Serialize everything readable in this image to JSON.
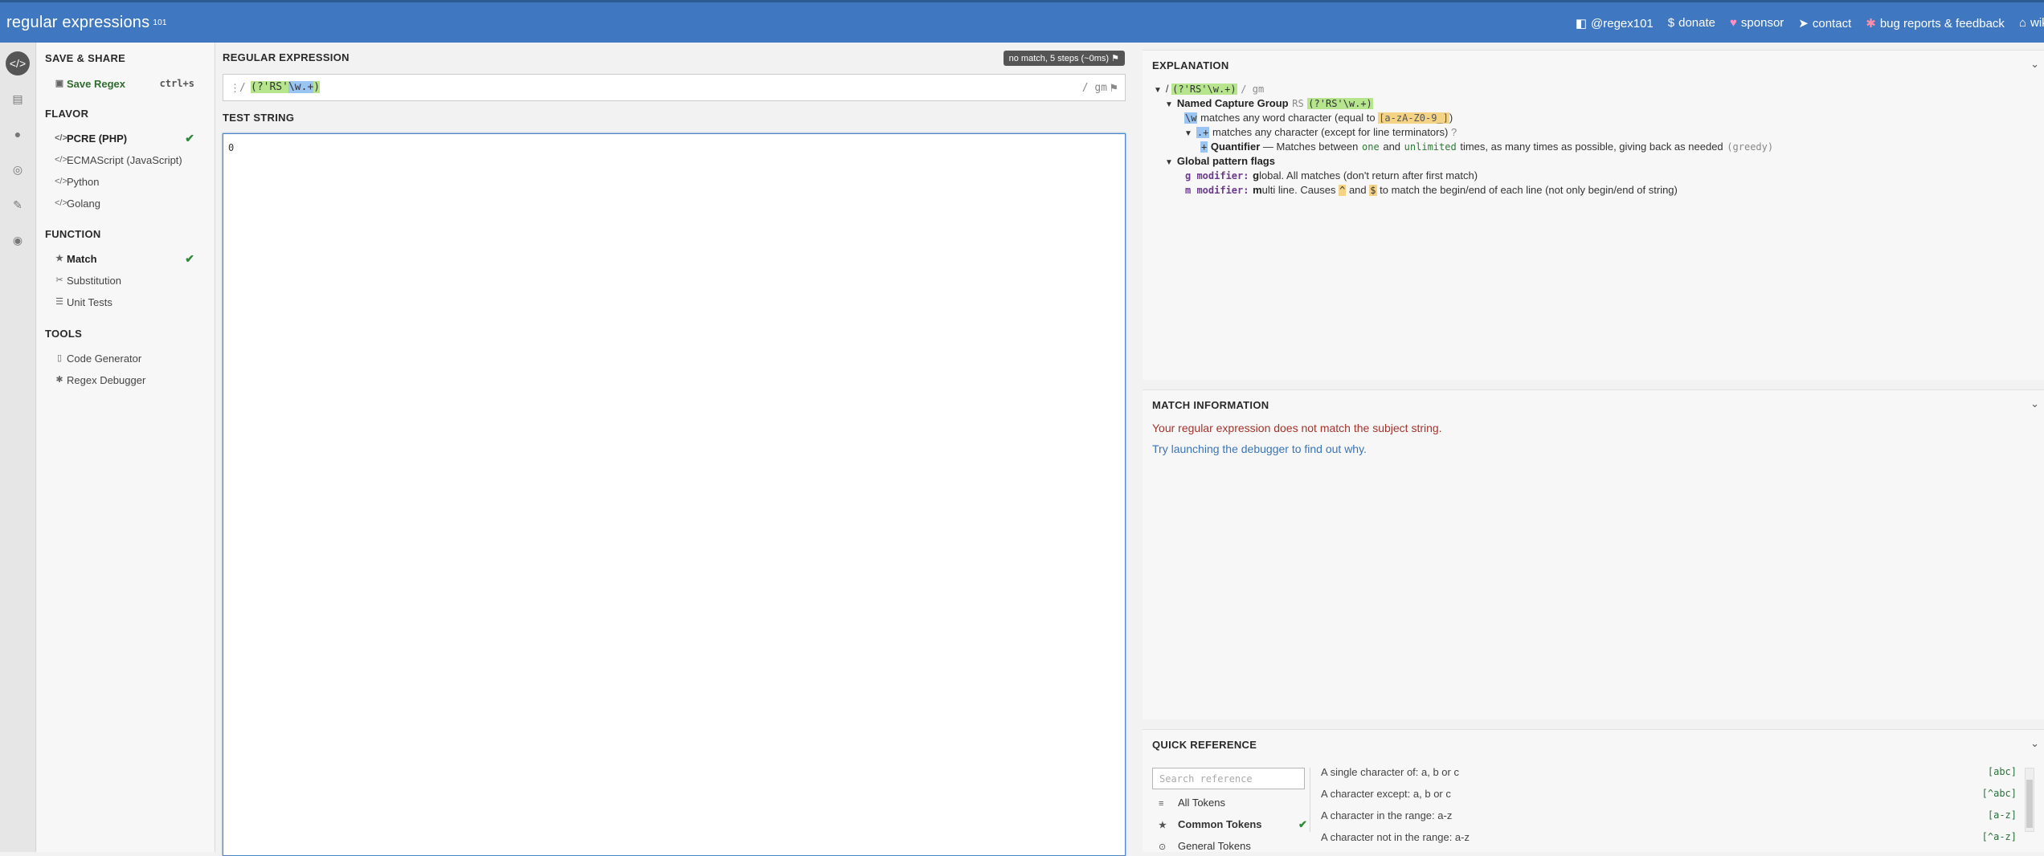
{
  "header": {
    "logo": "regular expressions",
    "logo_sub": "101",
    "links": [
      {
        "icon": "twitter-icon",
        "glyph": "◧",
        "label": "@regex101"
      },
      {
        "icon": "dollar-icon",
        "glyph": "$",
        "label": "donate"
      },
      {
        "icon": "heart-icon",
        "glyph": "♥",
        "label": "sponsor"
      },
      {
        "icon": "send-icon",
        "glyph": "➤",
        "label": "contact"
      },
      {
        "icon": "bug-icon",
        "glyph": "✱",
        "label": "bug reports & feedback"
      },
      {
        "icon": "bank-icon",
        "glyph": "⌂",
        "label": "wiki"
      }
    ]
  },
  "sidebar": {
    "save_share": {
      "title": "SAVE & SHARE",
      "save_label": "Save Regex",
      "shortcut": "ctrl+s"
    },
    "flavor": {
      "title": "FLAVOR",
      "items": [
        {
          "label": "PCRE (PHP)",
          "selected": true
        },
        {
          "label": "ECMAScript (JavaScript)",
          "selected": false
        },
        {
          "label": "Python",
          "selected": false
        },
        {
          "label": "Golang",
          "selected": false
        }
      ]
    },
    "function": {
      "title": "FUNCTION",
      "items": [
        {
          "label": "Match",
          "selected": true
        },
        {
          "label": "Substitution",
          "selected": false
        },
        {
          "label": "Unit Tests",
          "selected": false
        }
      ]
    },
    "tools": {
      "title": "TOOLS",
      "items": [
        {
          "label": "Code Generator"
        },
        {
          "label": "Regex Debugger"
        }
      ]
    }
  },
  "editor": {
    "regex_label": "REGULAR EXPRESSION",
    "status": "no match, 5 steps (~0ms)",
    "delimiter_open": "/",
    "regex_parts": {
      "group_open": "(?'RS'",
      "escape": "\\w",
      "quant": ".+",
      "group_close": ")"
    },
    "flags": "/ gm",
    "test_label": "TEST STRING",
    "test_string": "0"
  },
  "explanation": {
    "title": "EXPLANATION",
    "root": {
      "open": "/",
      "regex": "(?'RS'\\w.+)",
      "close": "/ gm"
    },
    "group": {
      "label": "Named Capture Group",
      "name": "RS",
      "token": "(?'RS'\\w.+)"
    },
    "word": {
      "token": "\\w",
      "text": "matches any word character (equal to",
      "class": "[a-zA-Z0-9_]",
      "close": ")"
    },
    "any": {
      "token": ".+",
      "text": "matches any character (except for line terminators)"
    },
    "quant": {
      "token": "+",
      "label": "Quantifier",
      "text1": "— Matches between",
      "one": "one",
      "and": "and",
      "unlimited": "unlimited",
      "text2": "times, as many times as possible, giving back as needed",
      "greedy": "(greedy)"
    },
    "flags_label": "Global pattern flags",
    "g_flag": {
      "mod": "g modifier:",
      "first": "g",
      "rest": "lobal. All matches (don't return after first match)"
    },
    "m_flag": {
      "mod": "m modifier:",
      "first": "m",
      "rest1": "ulti line. Causes",
      "caret": "^",
      "and": "and",
      "dollar": "$",
      "rest2": "to match the begin/end of each line (not only begin/end of string)"
    }
  },
  "match_info": {
    "title": "MATCH INFORMATION",
    "error": "Your regular expression does not match the subject string.",
    "link": "Try launching the debugger to find out why."
  },
  "quick_ref": {
    "title": "QUICK REFERENCE",
    "search_placeholder": "Search reference",
    "categories": [
      {
        "icon": "database-icon",
        "glyph": "≡",
        "label": "All Tokens",
        "selected": false
      },
      {
        "icon": "star-icon",
        "glyph": "★",
        "label": "Common Tokens",
        "selected": true
      },
      {
        "icon": "circle-dot-icon",
        "glyph": "⊙",
        "label": "General Tokens",
        "selected": false
      }
    ],
    "rows": [
      {
        "desc": "A single character of: a, b or c",
        "token": "[abc]"
      },
      {
        "desc": "A character except: a, b or c",
        "token": "[^abc]"
      },
      {
        "desc": "A character in the range: a-z",
        "token": "[a-z]"
      },
      {
        "desc": "A character not in the range: a-z",
        "token": "[^a-z]"
      }
    ]
  }
}
